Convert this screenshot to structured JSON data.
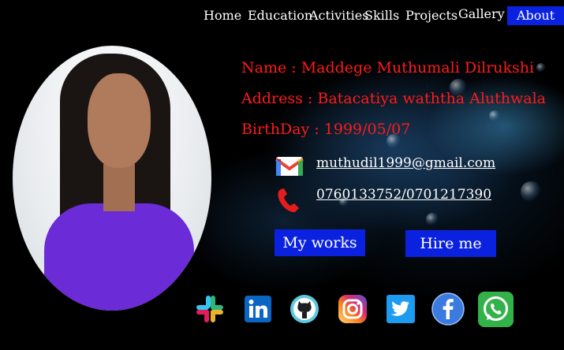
{
  "nav": {
    "home": "Home",
    "education": "Education",
    "activities": "Activities",
    "skills": "Skills",
    "projects": "Projects",
    "gallery": "Gallery",
    "about": "About"
  },
  "profile": {
    "name_line": "Name     : Maddege Muthumali Dilrukshi",
    "address_line": "Address  : Batacatiya waththa Aluthwala",
    "birthday_line": "BirthDay : 1999/05/07"
  },
  "contact": {
    "email": "muthudil1999@gmail.com",
    "phone": "0760133752/0701217390"
  },
  "buttons": {
    "my_works": "My works",
    "hire_me": "Hire me"
  },
  "social_icons": [
    "slack-icon",
    "linkedin-icon",
    "github-icon",
    "instagram-icon",
    "twitter-icon",
    "facebook-icon",
    "whatsapp-icon"
  ],
  "colors": {
    "accent": "#0a22e0",
    "info_text": "#ff1a1a"
  }
}
